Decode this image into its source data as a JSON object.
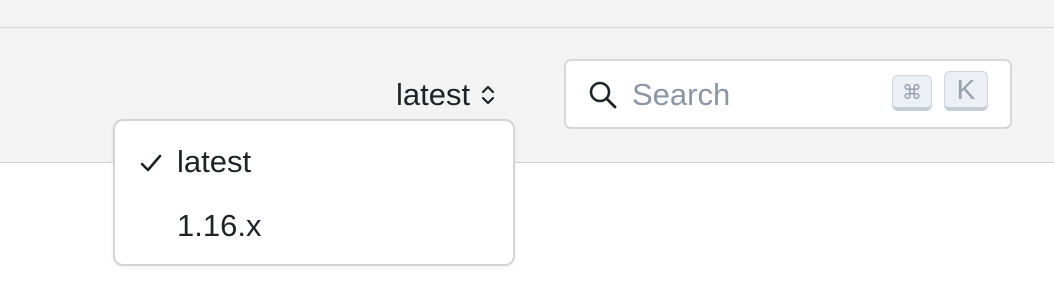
{
  "header": {
    "version_selector": {
      "label": "latest",
      "icon": "updown-chevron-icon"
    },
    "search": {
      "placeholder": "Search",
      "value": "",
      "icon": "search-icon",
      "shortcut_keys": [
        "⌘",
        "K"
      ]
    }
  },
  "version_menu": {
    "options": [
      {
        "label": "latest",
        "selected": true
      },
      {
        "label": "1.16.x",
        "selected": false
      }
    ]
  },
  "colors": {
    "header_bg": "#f3f3f3",
    "text": "#1f2328",
    "placeholder": "#8c95a3",
    "border": "#d7d7d7"
  }
}
